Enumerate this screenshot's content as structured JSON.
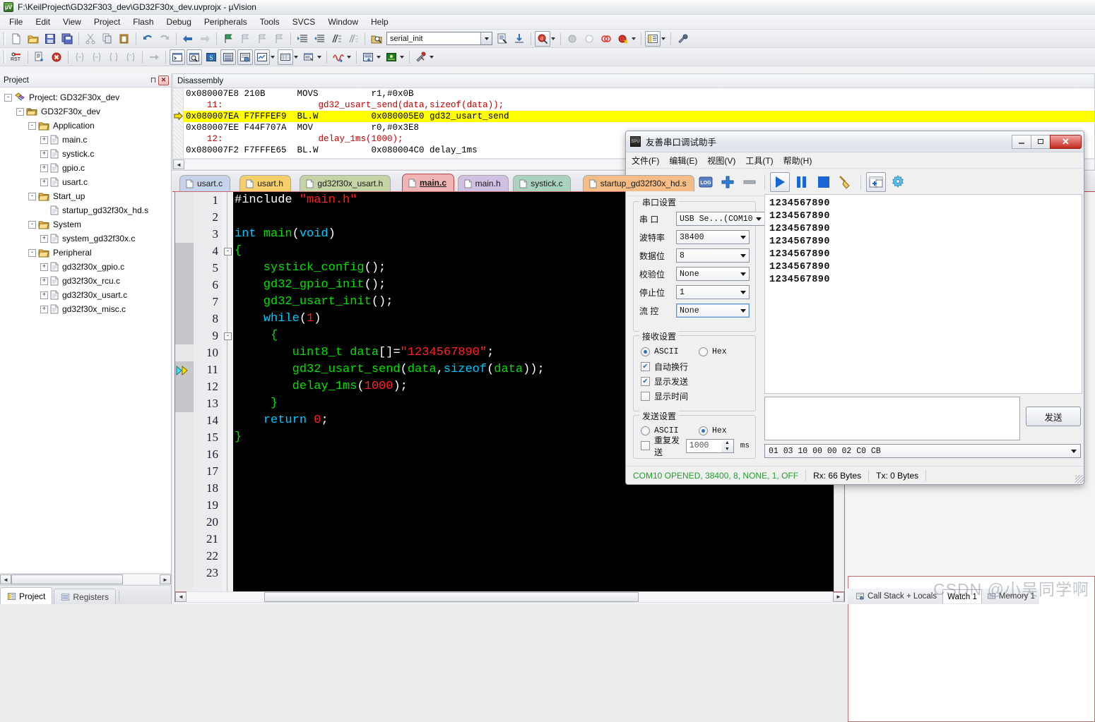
{
  "window": {
    "title": "F:\\KeilProject\\GD32F303_dev\\GD32F30x_dev.uvprojx - µVision",
    "logo_text": "µV"
  },
  "menubar": {
    "items": [
      "File",
      "Edit",
      "View",
      "Project",
      "Flash",
      "Debug",
      "Peripherals",
      "Tools",
      "SVCS",
      "Window",
      "Help"
    ]
  },
  "toolbar": {
    "function_combo_value": "serial_init",
    "icons_row1": [
      "new-file-icon",
      "open-folder-icon",
      "save-icon",
      "save-all-icon",
      "cut-icon",
      "copy-icon",
      "paste-icon",
      "undo-icon",
      "redo-icon",
      "back-icon",
      "forward-icon",
      "bookmark-icon",
      "bookmark-prev-icon",
      "bookmark-next-icon",
      "bookmark-clear-icon",
      "indent-icon",
      "outdent-icon",
      "comment-icon",
      "uncomment-icon"
    ],
    "icons_row2": [
      "reset-icon",
      "run-to-main-icon",
      "stop-debug-icon",
      "step-icon",
      "step-over-icon",
      "step-out-icon",
      "run-to-cursor-icon",
      "show-statement-icon",
      "command-window-icon",
      "disassembly-window-icon",
      "symbols-window-icon",
      "registers-window-icon",
      "call-stack-icon",
      "watch-window-icon",
      "memory-window-icon",
      "serial-window-icon",
      "analysis-icon",
      "trace-icon",
      "system-viewer-icon",
      "toolbox-icon"
    ]
  },
  "project_panel": {
    "title": "Project",
    "tree": [
      {
        "label": "Project: GD32F30x_dev",
        "depth": 0,
        "expander": "-",
        "icon": "project-icon"
      },
      {
        "label": "GD32F30x_dev",
        "depth": 1,
        "expander": "-",
        "icon": "target-icon"
      },
      {
        "label": "Application",
        "depth": 2,
        "expander": "-",
        "icon": "folder-icon"
      },
      {
        "label": "main.c",
        "depth": 3,
        "expander": "+",
        "icon": "file-icon"
      },
      {
        "label": "systick.c",
        "depth": 3,
        "expander": "+",
        "icon": "file-icon"
      },
      {
        "label": "gpio.c",
        "depth": 3,
        "expander": "+",
        "icon": "file-icon"
      },
      {
        "label": "usart.c",
        "depth": 3,
        "expander": "+",
        "icon": "file-icon"
      },
      {
        "label": "Start_up",
        "depth": 2,
        "expander": "-",
        "icon": "folder-icon"
      },
      {
        "label": "startup_gd32f30x_hd.s",
        "depth": 3,
        "expander": "",
        "icon": "file-icon"
      },
      {
        "label": "System",
        "depth": 2,
        "expander": "-",
        "icon": "folder-icon"
      },
      {
        "label": "system_gd32f30x.c",
        "depth": 3,
        "expander": "+",
        "icon": "file-icon"
      },
      {
        "label": "Peripheral",
        "depth": 2,
        "expander": "-",
        "icon": "folder-icon"
      },
      {
        "label": "gd32f30x_gpio.c",
        "depth": 3,
        "expander": "+",
        "icon": "file-icon"
      },
      {
        "label": "gd32f30x_rcu.c",
        "depth": 3,
        "expander": "+",
        "icon": "file-icon"
      },
      {
        "label": "gd32f30x_usart.c",
        "depth": 3,
        "expander": "+",
        "icon": "file-icon"
      },
      {
        "label": "gd32f30x_misc.c",
        "depth": 3,
        "expander": "+",
        "icon": "file-icon"
      }
    ],
    "bottom_tabs": [
      {
        "label": "Project",
        "active": true,
        "icon": "project-tab-icon"
      },
      {
        "label": "Registers",
        "active": false,
        "icon": "registers-tab-icon"
      }
    ]
  },
  "disassembly": {
    "title": "Disassembly",
    "lines": [
      {
        "kind": "asm",
        "addr": "0x080007E8",
        "code": "210B",
        "mnem": "MOVS",
        "ops": "r1,#0x0B",
        "current": false
      },
      {
        "kind": "src",
        "text": "    11:                  gd32_usart_send(data,sizeof(data));",
        "current": false
      },
      {
        "kind": "asm",
        "addr": "0x080007EA",
        "code": "F7FFFEF9",
        "mnem": "BL.W",
        "ops": "0x080005E0 gd32_usart_send",
        "current": true
      },
      {
        "kind": "asm",
        "addr": "0x080007EE",
        "code": "F44F707A",
        "mnem": "MOV",
        "ops": "r0,#0x3E8",
        "current": false
      },
      {
        "kind": "src",
        "text": "    12:                  delay_1ms(1000);",
        "current": false
      },
      {
        "kind": "asm",
        "addr": "0x080007F2",
        "code": "F7FFFE65",
        "mnem": "BL.W",
        "ops": "0x080004C0 delay_1ms",
        "current": false
      }
    ]
  },
  "editor": {
    "tabs": [
      {
        "label": "usart.c",
        "active": false,
        "color": "#c7d3ea"
      },
      {
        "label": "usart.h",
        "active": false,
        "color": "#f5cf6a"
      },
      {
        "label": "gd32f30x_usart.h",
        "active": false,
        "color": "#c4d4a5"
      },
      {
        "label": "main.c",
        "active": true,
        "color": "#f0b4b4"
      },
      {
        "label": "main.h",
        "active": false,
        "color": "#cfc0e4"
      },
      {
        "label": "systick.c",
        "active": false,
        "color": "#a9d3bf"
      },
      {
        "label": "startup_gd32f30x_hd.s",
        "active": false,
        "color": "#f5bc86"
      }
    ],
    "current_line_marker": 11,
    "line_count_visible": 23,
    "code_lines": [
      {
        "n": 1,
        "tokens": [
          {
            "t": "#include ",
            "c": "pp"
          },
          {
            "t": "\"main.h\"",
            "c": "str"
          }
        ]
      },
      {
        "n": 2,
        "tokens": []
      },
      {
        "n": 3,
        "tokens": [
          {
            "t": "int ",
            "c": "kw"
          },
          {
            "t": "main",
            "c": "fn"
          },
          {
            "t": "(",
            "c": "pl"
          },
          {
            "t": "void",
            "c": "kw"
          },
          {
            "t": ")",
            "c": "pl"
          }
        ]
      },
      {
        "n": 4,
        "tokens": [
          {
            "t": "{",
            "c": "fn"
          }
        ],
        "fold": "-"
      },
      {
        "n": 5,
        "tokens": [
          {
            "t": "    systick_config",
            "c": "fn"
          },
          {
            "t": "();",
            "c": "pl"
          }
        ]
      },
      {
        "n": 6,
        "tokens": [
          {
            "t": "    gd32_gpio_init",
            "c": "fn"
          },
          {
            "t": "();",
            "c": "pl"
          }
        ]
      },
      {
        "n": 7,
        "tokens": [
          {
            "t": "    gd32_usart_init",
            "c": "fn"
          },
          {
            "t": "();",
            "c": "pl"
          }
        ]
      },
      {
        "n": 8,
        "tokens": [
          {
            "t": "    ",
            "c": "pl"
          },
          {
            "t": "while",
            "c": "kw"
          },
          {
            "t": "(",
            "c": "pl"
          },
          {
            "t": "1",
            "c": "num"
          },
          {
            "t": ")",
            "c": "pl"
          }
        ]
      },
      {
        "n": 9,
        "tokens": [
          {
            "t": "     {",
            "c": "fn"
          }
        ],
        "fold": "-"
      },
      {
        "n": 10,
        "tokens": [
          {
            "t": "        uint8_t data",
            "c": "fn"
          },
          {
            "t": "[]=",
            "c": "pl"
          },
          {
            "t": "\"1234567890\"",
            "c": "str"
          },
          {
            "t": ";",
            "c": "pl"
          }
        ]
      },
      {
        "n": 11,
        "tokens": [
          {
            "t": "        gd32_usart_send",
            "c": "fn"
          },
          {
            "t": "(",
            "c": "pl"
          },
          {
            "t": "data",
            "c": "fn"
          },
          {
            "t": ",",
            "c": "pl"
          },
          {
            "t": "sizeof",
            "c": "kw"
          },
          {
            "t": "(",
            "c": "pl"
          },
          {
            "t": "data",
            "c": "fn"
          },
          {
            "t": "));",
            "c": "pl"
          }
        ]
      },
      {
        "n": 12,
        "tokens": [
          {
            "t": "        delay_1ms",
            "c": "fn"
          },
          {
            "t": "(",
            "c": "pl"
          },
          {
            "t": "1000",
            "c": "num"
          },
          {
            "t": ");",
            "c": "pl"
          }
        ]
      },
      {
        "n": 13,
        "tokens": [
          {
            "t": "     }",
            "c": "fn"
          }
        ]
      },
      {
        "n": 14,
        "tokens": [
          {
            "t": "    ",
            "c": "pl"
          },
          {
            "t": "return ",
            "c": "kw"
          },
          {
            "t": "0",
            "c": "num"
          },
          {
            "t": ";",
            "c": "pl"
          }
        ]
      },
      {
        "n": 15,
        "tokens": [
          {
            "t": "}",
            "c": "fn"
          }
        ]
      },
      {
        "n": 16,
        "tokens": []
      },
      {
        "n": 17,
        "tokens": []
      },
      {
        "n": 18,
        "tokens": []
      },
      {
        "n": 19,
        "tokens": []
      },
      {
        "n": 20,
        "tokens": []
      },
      {
        "n": 21,
        "tokens": []
      },
      {
        "n": 22,
        "tokens": []
      },
      {
        "n": 23,
        "tokens": []
      }
    ]
  },
  "debug_tabs": [
    {
      "label": "Call Stack + Locals",
      "active": false,
      "icon": "call-stack-icon"
    },
    {
      "label": "Watch 1",
      "active": true,
      "icon": ""
    },
    {
      "label": "Memory 1",
      "active": false,
      "icon": "memory-icon"
    }
  ],
  "serial_dialog": {
    "title": "友善串口调试助手",
    "window_buttons": [
      "minimize",
      "maximize",
      "close"
    ],
    "menu": [
      "文件(F)",
      "编辑(E)",
      "视图(V)",
      "工具(T)",
      "帮助(H)"
    ],
    "toolbar_icons": [
      "new-icon",
      "open-icon",
      "save-icon",
      "log-icon",
      "add-icon",
      "remove-icon",
      "play-icon",
      "pause-icon",
      "stop-icon",
      "clear-broom-icon",
      "add-window-icon",
      "settings-gear-icon"
    ],
    "port_settings": {
      "legend": "串口设置",
      "fields": [
        {
          "label": "串  口",
          "value": "USB Se...(COM10",
          "focused": false
        },
        {
          "label": "波特率",
          "value": "38400",
          "focused": false
        },
        {
          "label": "数据位",
          "value": "8",
          "focused": false
        },
        {
          "label": "校验位",
          "value": "None",
          "focused": false
        },
        {
          "label": "停止位",
          "value": "1",
          "focused": false
        },
        {
          "label": "流  控",
          "value": "None",
          "focused": true
        }
      ]
    },
    "receive_settings": {
      "legend": "接收设置",
      "mode": [
        {
          "label": "ASCII",
          "checked": true
        },
        {
          "label": "Hex",
          "checked": false
        }
      ],
      "checks": [
        {
          "label": "自动换行",
          "checked": true
        },
        {
          "label": "显示发送",
          "checked": true
        },
        {
          "label": "显示时间",
          "checked": false
        }
      ]
    },
    "send_settings": {
      "legend": "发送设置",
      "mode": [
        {
          "label": "ASCII",
          "checked": false
        },
        {
          "label": "Hex",
          "checked": true
        }
      ],
      "repeat": {
        "label": "重复发送",
        "checked": false,
        "interval": "1000",
        "unit": "ms"
      }
    },
    "receive_area": {
      "lines": [
        "1234567890",
        "1234567890",
        "1234567890",
        "1234567890",
        "1234567890",
        "1234567890",
        "1234567890"
      ]
    },
    "send_area": {
      "value": ""
    },
    "history_combo": {
      "value": "01 03 10 00 00 02 C0 CB"
    },
    "send_button": "发送",
    "status": {
      "connection": "COM10 OPENED, 38400, 8, NONE, 1, OFF",
      "rx": "Rx: 66 Bytes",
      "tx": "Tx: 0 Bytes"
    }
  },
  "watermark": "CSDN @小吴同学啊",
  "colors": {
    "highlight_yellow": "#ffff00",
    "accent_red": "#c2281f",
    "status_green": "#1f9e2c",
    "editor_bg": "#000000"
  }
}
